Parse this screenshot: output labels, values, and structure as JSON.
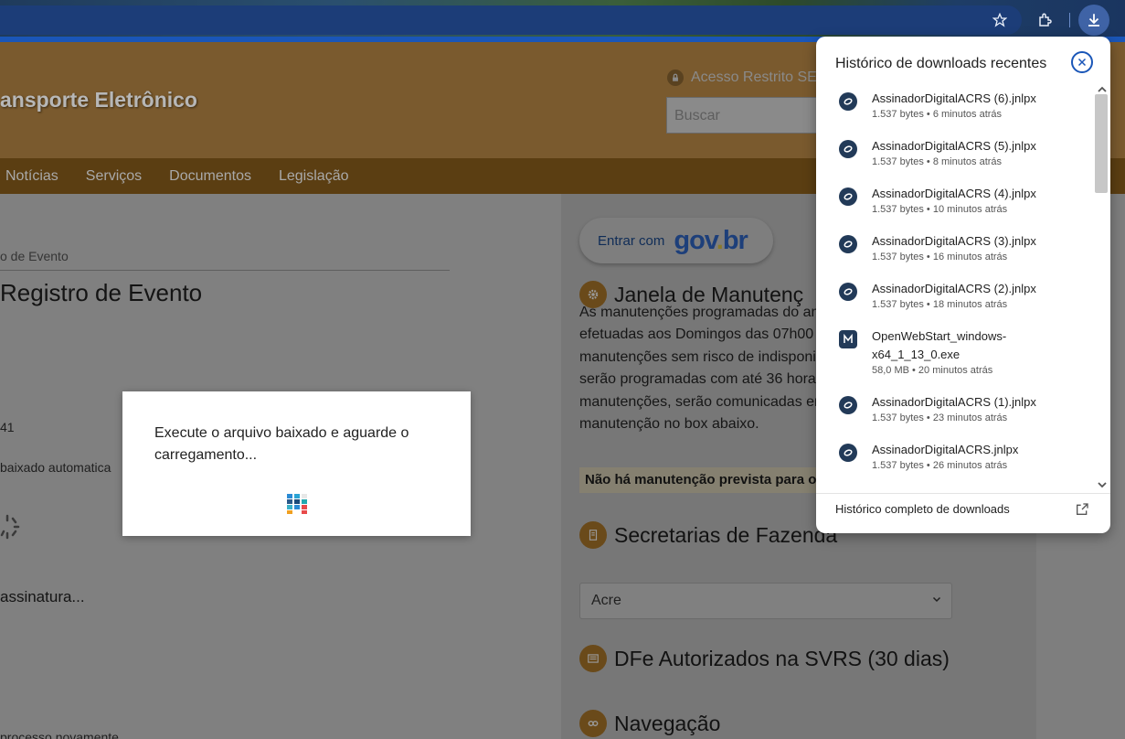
{
  "page": {
    "site_title": "ansporte Eletrônico",
    "restricted": "Acesso Restrito SE",
    "search_placeholder": "Buscar",
    "nav": [
      "Notícias",
      "Serviços",
      "Documentos",
      "Legislação"
    ],
    "breadcrumb": "o de Evento",
    "heading": "Registro de Evento",
    "text_41": "41",
    "text_baixado": "baixado automatica",
    "text_assinatura": "assinatura...",
    "text_processo": "processo novamente",
    "govbr_enter": "Entrar com",
    "govbr_logo": "gov.br",
    "sections": {
      "janela": "Janela de Manutenç",
      "secretarias": "Secretarias de Fazenda",
      "dfe": "DFe Autorizados na SVRS (30 dias)",
      "navegacao": "Navegação"
    },
    "janela_lines": [
      "As manutenções programadas do am",
      "efetuadas aos Domingos das 07h00 à",
      "manutenções sem risco de indisponil",
      "serão programadas com até 36 horas",
      "manutenções, serão comunicadas en",
      "manutenção no box abaixo."
    ],
    "no_maintenance": "Não há manutenção prevista para o",
    "select_value": "Acre"
  },
  "modal": {
    "message": "Execute o arquivo baixado e aguarde o carregamento..."
  },
  "downloads": {
    "title": "Histórico de downloads recentes",
    "items": [
      {
        "name": "AssinadorDigitalACRS (6).jnlpx",
        "meta": "1.537 bytes • 6 minutos atrás"
      },
      {
        "name": "AssinadorDigitalACRS (5).jnlpx",
        "meta": "1.537 bytes • 8 minutos atrás"
      },
      {
        "name": "AssinadorDigitalACRS (4).jnlpx",
        "meta": "1.537 bytes • 10 minutos atrás"
      },
      {
        "name": "AssinadorDigitalACRS (3).jnlpx",
        "meta": "1.537 bytes • 16 minutos atrás"
      },
      {
        "name": "AssinadorDigitalACRS (2).jnlpx",
        "meta": "1.537 bytes • 18 minutos atrás"
      },
      {
        "name": "OpenWebStart_windows-",
        "name2": "x64_1_13_0.exe",
        "meta": "58,0 MB • 20 minutos atrás"
      },
      {
        "name": "AssinadorDigitalACRS (1).jnlpx",
        "meta": "1.537 bytes • 23 minutos atrás"
      },
      {
        "name": "AssinadorDigitalACRS.jnlpx",
        "meta": "1.537 bytes • 26 minutos atrás"
      }
    ],
    "footer": "Histórico completo de downloads"
  },
  "colors": {
    "accent": "#1a56b8",
    "gov_blue": "#1351b4",
    "gov_yellow": "#ffcd07",
    "gov_green": "#168821"
  }
}
